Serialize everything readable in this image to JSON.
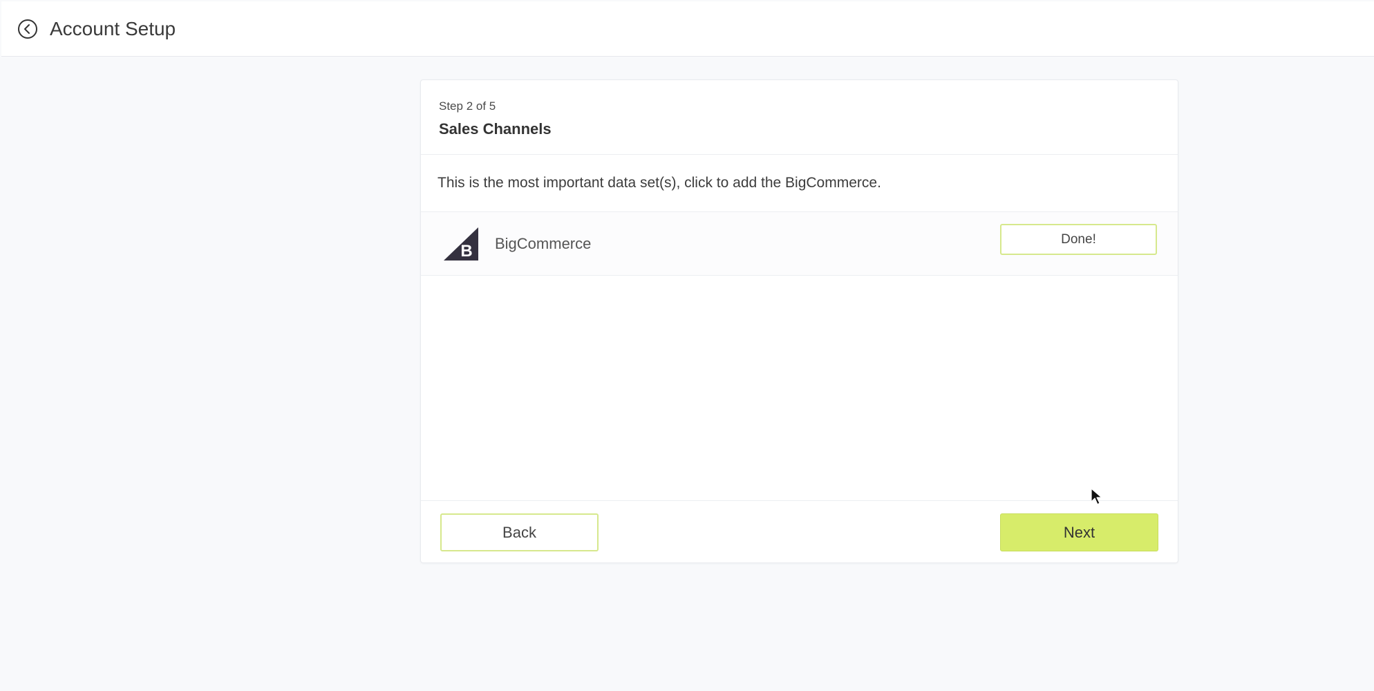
{
  "header": {
    "title": "Account Setup",
    "back_icon": "circle-chevron-left-icon"
  },
  "wizard": {
    "step_text": "Step 2 of 5",
    "section_title": "Sales Channels",
    "intro_text": "This is the most important data set(s), click to add the BigCommerce.",
    "channels": [
      {
        "name": "BigCommerce",
        "logo_icon": "bigcommerce-logo",
        "status_label": "Done!"
      }
    ],
    "footer": {
      "back_label": "Back",
      "next_label": "Next"
    }
  },
  "colors": {
    "accent": "#d7ec6a",
    "accent_border": "#d6e88c",
    "background": "#f8f9fb",
    "logo": "#34313f"
  }
}
